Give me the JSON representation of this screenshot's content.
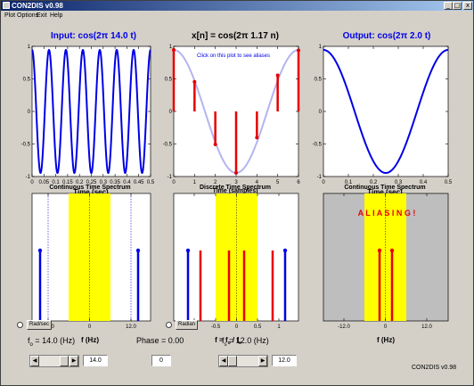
{
  "window": {
    "title": "CON2DIS v0.98",
    "minimize": "_",
    "maximize": "□",
    "close": "x"
  },
  "menu": {
    "items": [
      "Plot Options",
      "Exit",
      "Help"
    ]
  },
  "plots": {
    "input": {
      "title": "Input: cos(2π 14.0 t)",
      "xlabel": "Time (sec)",
      "xticks": [
        "0",
        "0.05",
        "0.1",
        "0.15",
        "0.2",
        "0.25",
        "0.3",
        "0.35",
        "0.4",
        "0.45",
        "0.5"
      ],
      "yticks": [
        "1",
        "0.5",
        "0",
        "-0.5",
        "-1"
      ]
    },
    "discrete": {
      "title": "x[n] = cos(2π 1.17 n)",
      "xlabel": "Time (samples)",
      "annotation": "Click on this plot to see aliases",
      "xticks": [
        "0",
        "1",
        "2",
        "3",
        "4",
        "5",
        "6"
      ],
      "yticks": [
        "1",
        "0.5",
        "0",
        "-0.5",
        "-1"
      ]
    },
    "output": {
      "title": "Output: cos(2π 2.0 t)",
      "xlabel": "Time (sec)",
      "xticks": [
        "0",
        "0.1",
        "0.2",
        "0.3",
        "0.4",
        "0.5"
      ],
      "yticks": [
        "1",
        "0.5",
        "0",
        "-0.5",
        "-1"
      ]
    },
    "ct_spectrum_in": {
      "title": "Continuous Time Spectrum",
      "xlabel": "f (Hz)",
      "xticks": [
        "-12.0",
        "0",
        "12.0"
      ]
    },
    "dt_spectrum": {
      "title": "Discrete Time Spectrum",
      "xlabel_main": "f = f",
      "xlabel_sub1": "o",
      "xlabel_sep": " / f",
      "xlabel_sub2": "s",
      "xticks": [
        "-1",
        "-0.5",
        "0",
        "0.5",
        "1"
      ]
    },
    "ct_spectrum_out": {
      "title": "Continuous Time Spectrum",
      "xlabel": "f (Hz)",
      "alert": "A L I A S I N G !",
      "xticks": [
        "-12.0",
        "0",
        "12.0"
      ]
    }
  },
  "controls": {
    "rad_sec_label": "Rad/sec",
    "radian_label": "Radian",
    "fo_label_pre": "f",
    "fo_label_sub": "o",
    "fo_label_post": " = 14.0 (Hz)",
    "phase_label": "Phase = 0.00",
    "fs_label_pre": "f",
    "fs_label_sub": "s",
    "fs_label_post": " = 12.0 (Hz)",
    "fo_value": "14.0",
    "phase_value": "0",
    "fs_value": "12.0",
    "version": "CON2DIS v0.98"
  },
  "params": {
    "f_input": 14.0,
    "f_sample": 12.0,
    "f_output": 2.0,
    "f_digital": 1.17,
    "num_samples": 7
  },
  "colors": {
    "signal_blue": "#0000e6",
    "stem_red": "#e60000",
    "passband_yellow": "#ffff00",
    "alias_gray": "#bebebe",
    "reconstruct_light": "#b4b4f0"
  }
}
